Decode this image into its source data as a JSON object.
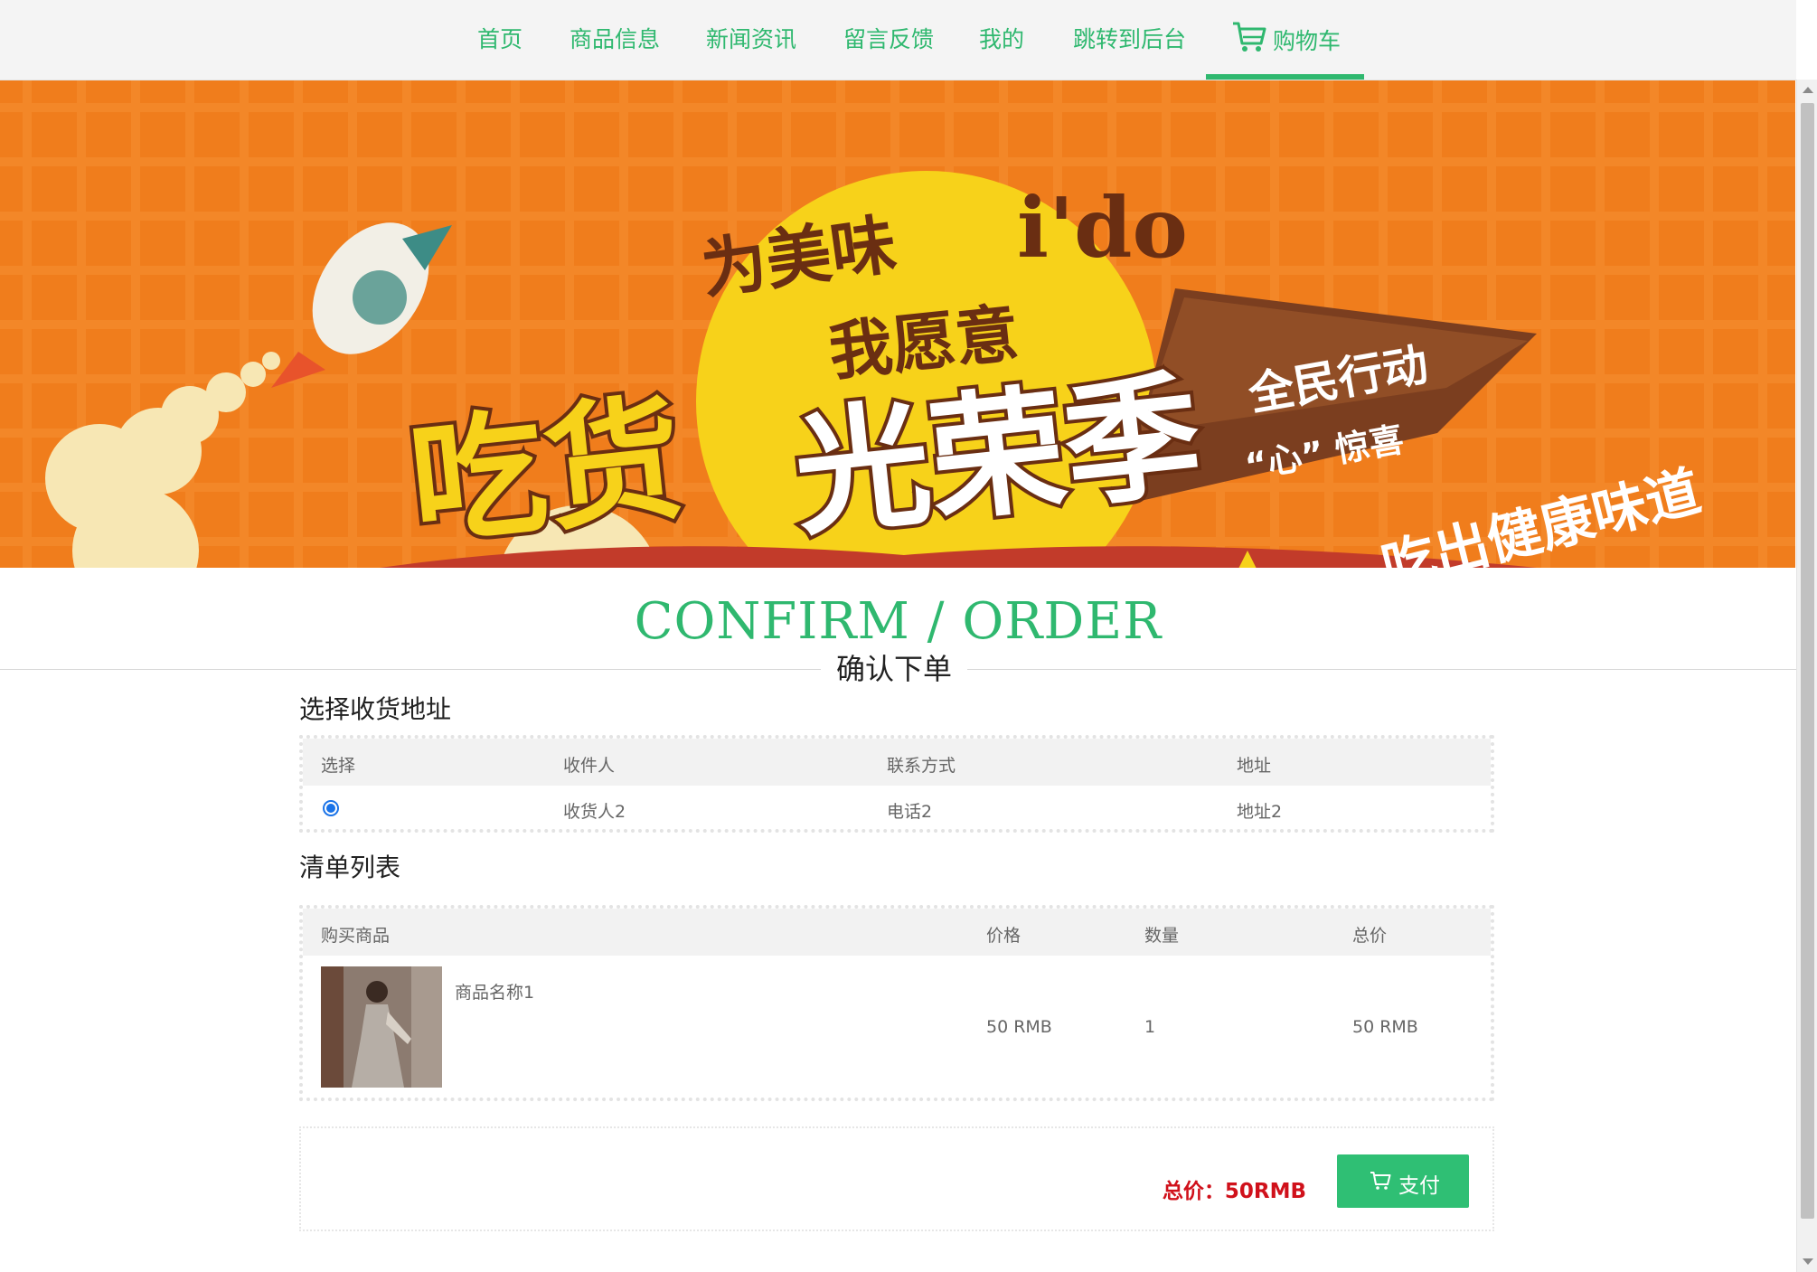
{
  "nav": {
    "items": [
      "首页",
      "商品信息",
      "新闻资讯",
      "留言反馈",
      "我的",
      "跳转到后台"
    ],
    "cart_label": "购物车",
    "accent_color": "#2fb86f"
  },
  "banner": {
    "line1": "为美味",
    "line2": "我愿意",
    "brand": "i'do",
    "headline_a": "吃货",
    "headline_b": "光荣季",
    "tag1": "全民行动",
    "tag2": "“心” 惊喜",
    "slogan": "吃出健康味道"
  },
  "heading": {
    "en": "CONFIRM / ORDER",
    "zh": "确认下单"
  },
  "address": {
    "title": "选择收货地址",
    "headers": [
      "选择",
      "收件人",
      "联系方式",
      "地址"
    ],
    "rows": [
      {
        "selected": true,
        "recipient": "收货人2",
        "contact": "电话2",
        "address": "地址2"
      }
    ]
  },
  "order": {
    "title": "清单列表",
    "headers": [
      "购买商品",
      "价格",
      "数量",
      "总价"
    ],
    "items": [
      {
        "name": "商品名称1",
        "price": "50 RMB",
        "qty": "1",
        "total": "50 RMB"
      }
    ]
  },
  "payment": {
    "total_label": "总价：50RMB",
    "pay_button": "支付",
    "total_color": "#d0111b",
    "button_color": "#2fbf74"
  }
}
